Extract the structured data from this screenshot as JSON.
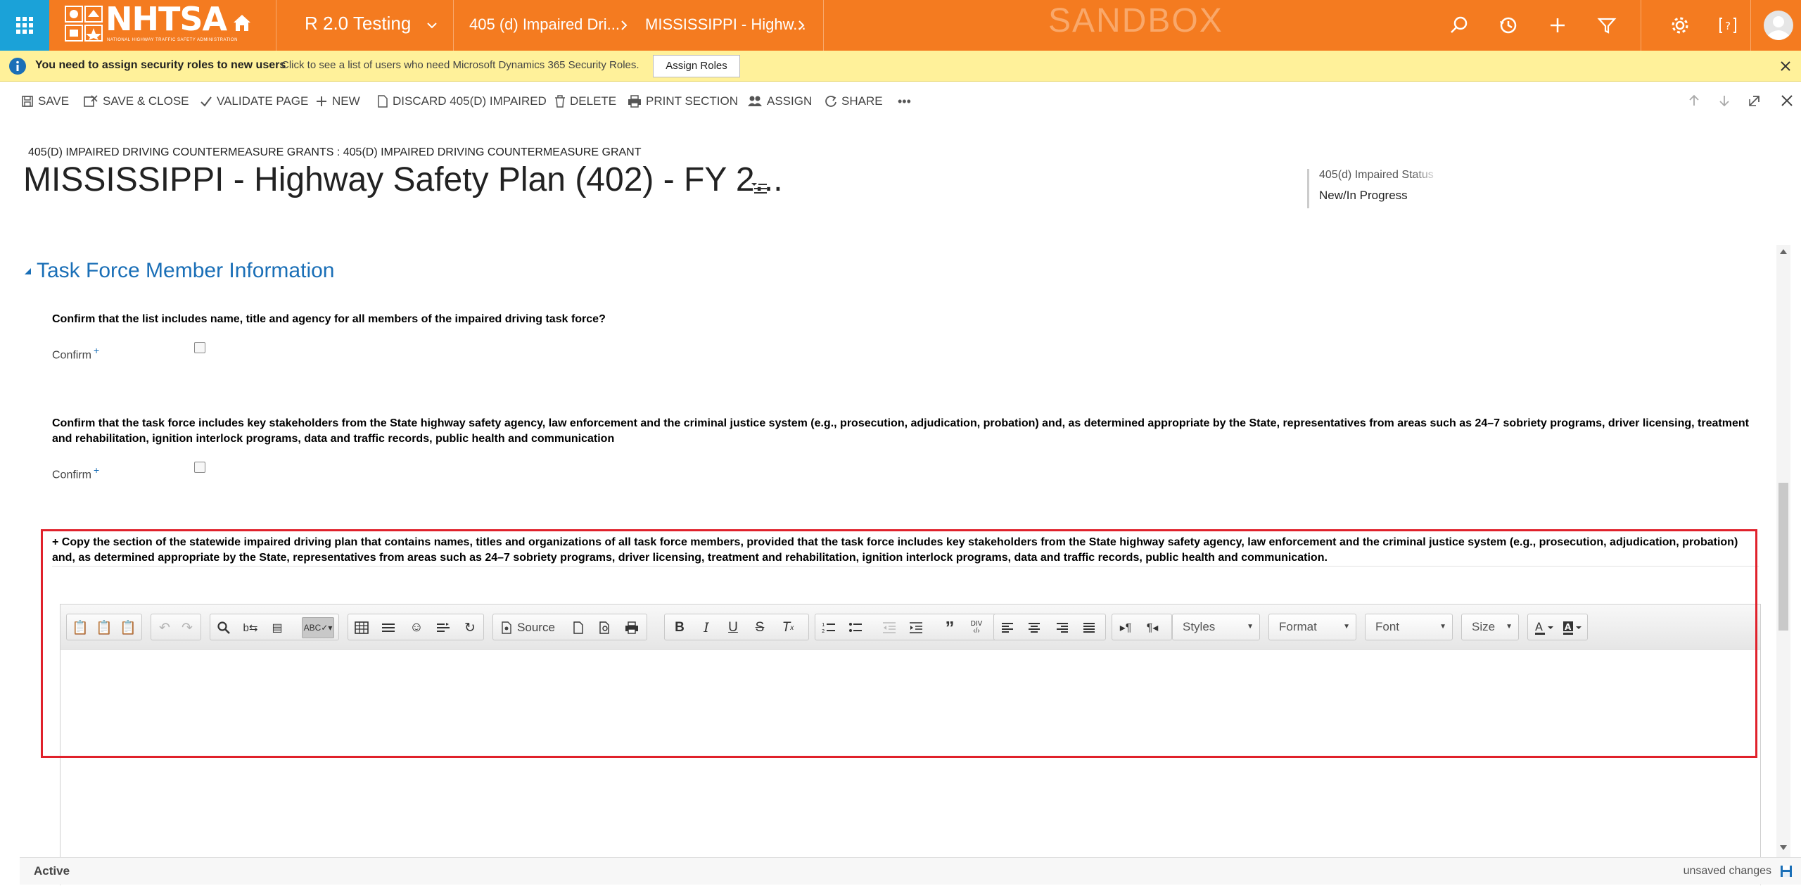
{
  "topnav": {
    "logo_text": "NHTSA",
    "logo_subtext": "NATIONAL HIGHWAY TRAFFIC SAFETY ADMINISTRATION",
    "app_name": "R 2.0 Testing",
    "breadcrumb_1": "405 (d) Impaired Dri...",
    "breadcrumb_2": "MISSISSIPPI - Highw...",
    "environment_label": "SANDBOX",
    "colors": {
      "bar": "#f47b20",
      "waffle": "#1ba2d8"
    }
  },
  "notification": {
    "title": "You need to assign security roles to new users",
    "message": "Click to see a list of users who need Microsoft Dynamics 365 Security Roles.",
    "button_label": "Assign Roles"
  },
  "commandbar": {
    "save": "SAVE",
    "save_close": "SAVE & CLOSE",
    "validate": "VALIDATE PAGE",
    "new": "NEW",
    "discard": "DISCARD 405(D) IMPAIRED",
    "delete": "DELETE",
    "print": "PRINT SECTION",
    "assign": "ASSIGN",
    "share": "SHARE",
    "more": "•••"
  },
  "header": {
    "entity_breadcrumb": "405(D) IMPAIRED DRIVING COUNTERMEASURE GRANTS : 405(D) IMPAIRED DRIVING COUNTERMEASURE GRANT",
    "title": "MISSISSIPPI - Highway Safety Plan (402) - FY 2...",
    "status_field_label": "405(d) Impaired Status",
    "status_field_value": "New/In Progress"
  },
  "section": {
    "title": "Task Force Member Information",
    "q1": "Confirm that the list includes name, title and agency for all members of the impaired driving task force?",
    "q1_label": "Confirm",
    "q2": "Confirm that the task force includes key stakeholders from the State highway safety agency, law enforcement and the criminal justice system (e.g., prosecution, adjudication, probation) and, as determined appropriate by the State, representatives from areas such as 24–7 sobriety programs, driver licensing, treatment and rehabilitation, ignition interlock programs, data and traffic records, public health and communication",
    "q2_label": "Confirm",
    "required_marker": "+",
    "q3": "+ Copy the section of the statewide impaired driving plan that contains names, titles and organizations of all task force members, provided that the task force includes key stakeholders from the State highway safety agency, law enforcement and the criminal justice system (e.g., prosecution, adjudication, probation) and, as determined appropriate by the State, representatives from areas such as 24–7 sobriety programs, driver licensing, treatment and rehabilitation, ignition interlock programs, data and traffic records, public health and communication."
  },
  "editor": {
    "source_label": "Source",
    "styles_label": "Styles",
    "format_label": "Format",
    "font_label": "Font",
    "size_label": "Size"
  },
  "footer": {
    "status": "Active",
    "unsaved": "unsaved changes"
  }
}
